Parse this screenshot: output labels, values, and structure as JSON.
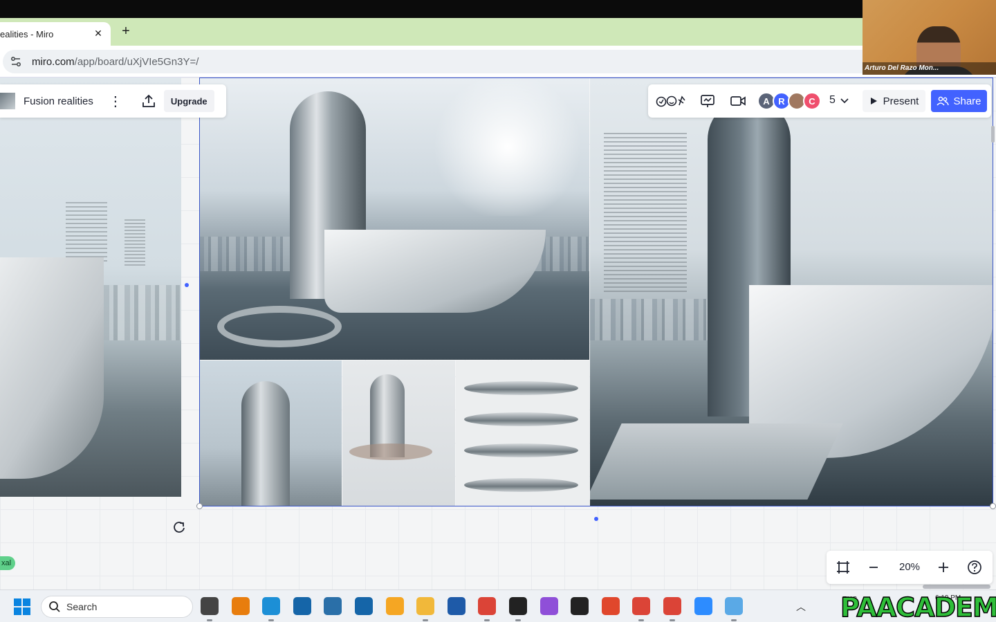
{
  "browser": {
    "tab_title": "ealities - Miro",
    "url_host": "miro.com",
    "url_path": "/app/board/uXjVIe5Gn3Y=/"
  },
  "board": {
    "name": "Fusion realities",
    "upgrade_label": "Upgrade"
  },
  "collab": {
    "avatars": [
      {
        "letter": "A",
        "color": "#5b6478"
      },
      {
        "letter": "R",
        "color": "#4262ff"
      },
      {
        "letter": "",
        "color": "#a07860"
      },
      {
        "letter": "C",
        "color": "#ef4f6d"
      }
    ],
    "participant_count": "5",
    "present_label": "Present",
    "share_label": "Share",
    "accent_color": "#4262ff"
  },
  "zoom": {
    "level": "20%"
  },
  "canvas": {
    "user_tag": "xal"
  },
  "webcam": {
    "name": "Arturo Del Razo Mon..."
  },
  "taskbar": {
    "search_label": "Search",
    "language": "ENG",
    "time": "6:19 PM",
    "apps": [
      {
        "name": "file-explorer-icon",
        "color": "#444"
      },
      {
        "name": "blender-icon",
        "color": "#e87d0d"
      },
      {
        "name": "edge-icon",
        "color": "#1c8fd6"
      },
      {
        "name": "sketchup-icon",
        "color": "#1565a8"
      },
      {
        "name": "app-12-icon",
        "color": "#2a6fa8"
      },
      {
        "name": "sketchup-2-icon",
        "color": "#1565a8"
      },
      {
        "name": "orange-app-icon",
        "color": "#f5a623"
      },
      {
        "name": "folder-icon",
        "color": "#f1b83a"
      },
      {
        "name": "revit-icon",
        "color": "#1e5aa8"
      },
      {
        "name": "chrome-icon",
        "color": "#db4437"
      },
      {
        "name": "rhino-icon",
        "color": "#222"
      },
      {
        "name": "purple-app-icon",
        "color": "#8f4fd8"
      },
      {
        "name": "media-player-icon",
        "color": "#222"
      },
      {
        "name": "office-icon",
        "color": "#e0472c"
      },
      {
        "name": "chrome-profile-icon",
        "color": "#db4437"
      },
      {
        "name": "chrome-active-icon",
        "color": "#db4437"
      },
      {
        "name": "zoom-icon",
        "color": "#2d8cff"
      },
      {
        "name": "snipping-tool-icon",
        "color": "#5aa9e6"
      }
    ]
  },
  "watermark": "PAACADEMY"
}
